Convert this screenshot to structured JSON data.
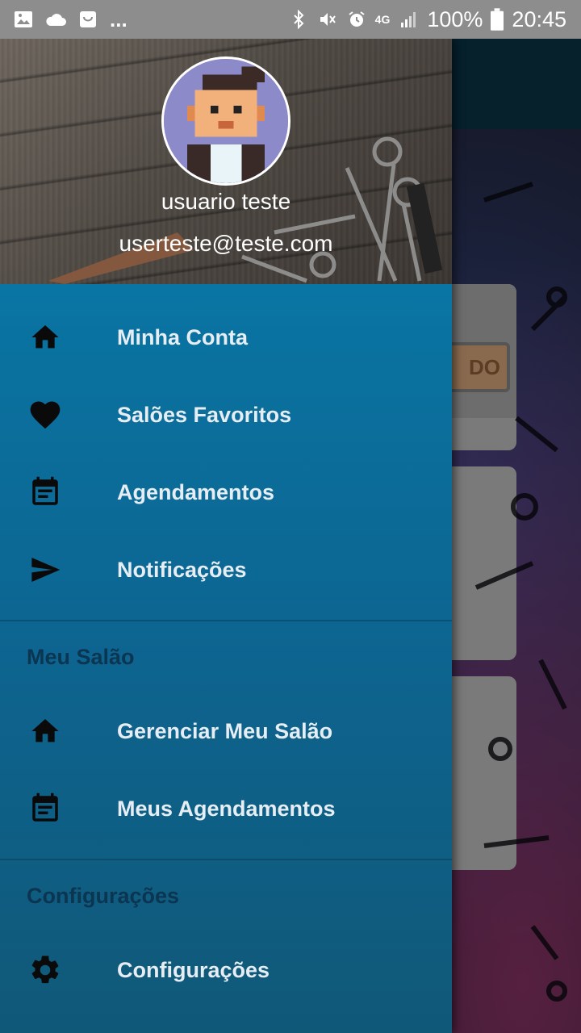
{
  "status_bar": {
    "battery": "100%",
    "time": "20:45",
    "network": "4G",
    "more": "...",
    "left_icons": [
      "image-icon",
      "cloud-icon",
      "shopping-bag-icon"
    ],
    "right_icons": [
      "bluetooth-icon",
      "mute-icon",
      "alarm-icon",
      "signal-icon",
      "battery-icon"
    ]
  },
  "drawer": {
    "user_name": "usuario teste",
    "user_email": "userteste@teste.com",
    "items": [
      {
        "label": "Minha Conta",
        "icon": "home-icon"
      },
      {
        "label": "Salões Favoritos",
        "icon": "heart-icon"
      },
      {
        "label": "Agendamentos",
        "icon": "calendar-icon"
      },
      {
        "label": "Notificações",
        "icon": "send-icon"
      }
    ],
    "section_salon": {
      "title": "Meu Salão",
      "items": [
        {
          "label": "Gerenciar Meu Salão",
          "icon": "home-icon"
        },
        {
          "label": "Meus Agendamentos",
          "icon": "calendar-icon"
        }
      ]
    },
    "section_settings": {
      "title": "Configurações",
      "items": [
        {
          "label": "Configurações",
          "icon": "gear-icon"
        }
      ]
    }
  },
  "background": {
    "card_badge": "DO"
  },
  "colors": {
    "drawer_top": "#0585b9",
    "drawer_bottom": "#105878",
    "section_title": "#0b3550",
    "status_bar": "#8d8d8d"
  }
}
